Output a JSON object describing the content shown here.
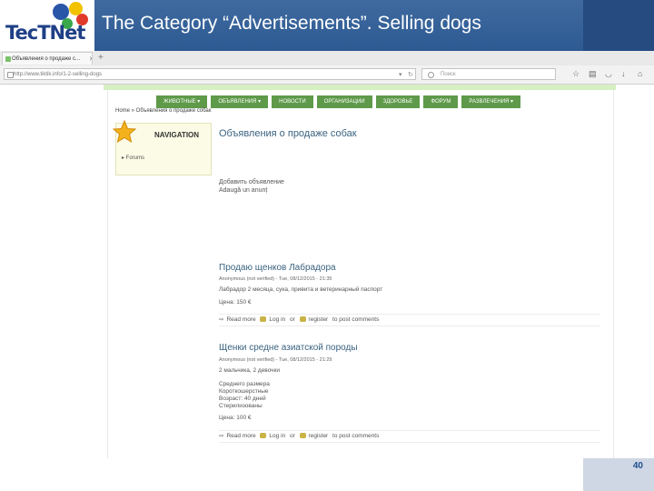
{
  "slide": {
    "title": "The Category “Advertisements”. Selling dogs",
    "logo": "TecTNet",
    "page_number": "40"
  },
  "browser": {
    "tab_title": "Объявления о продаже с...",
    "url": "http://www.tiktik.info/1-2-selling-dogs",
    "search_placeholder": "Поиск"
  },
  "site": {
    "nav": [
      "ЖИВОТНЫЕ ▾",
      "ОБЪЯВЛЕНИЯ ▾",
      "НОВОСТИ",
      "ОРГАНИЗАЦИИ",
      "ЗДОРОВЬЕ",
      "ФОРУМ",
      "РАЗВЛЕЧЕНИЯ ▾"
    ],
    "breadcrumb": "Home » Объявления о продаже собак",
    "navigation_title": "NAVIGATION",
    "navigation_link": "▸ Forums",
    "page_title": "Объявления о продаже собак",
    "add_link": "Добавить объявление",
    "add_link_ro": "Adaugă un anunț",
    "posts": [
      {
        "title": "Продаю щенков Лабрадора",
        "meta": "Anonymous (not verified) - Tue, 08/12/2015 - 21:35",
        "lines": [
          "Лабрадор 2 месяца, сука, привита и ветеринарный паспорт"
        ],
        "price": "Цена: 150 €",
        "read_more": "Read more",
        "log_in": "Log in",
        "or": "or",
        "register": "register",
        "to_post": "to post comments"
      },
      {
        "title": "Щенки средне азиатской породы",
        "meta": "Anonymous (not verified) - Tue, 08/12/2015 - 21:29",
        "lines": [
          "2 мальчика, 2 девочки",
          "",
          "Среднего размера",
          "Короткошерстные",
          "Возраст: 40 дней",
          "Стерилизованы"
        ],
        "price": "Цена: 100 €",
        "read_more": "Read more",
        "log_in": "Log in",
        "or": "or",
        "register": "register",
        "to_post": "to post comments"
      }
    ]
  }
}
